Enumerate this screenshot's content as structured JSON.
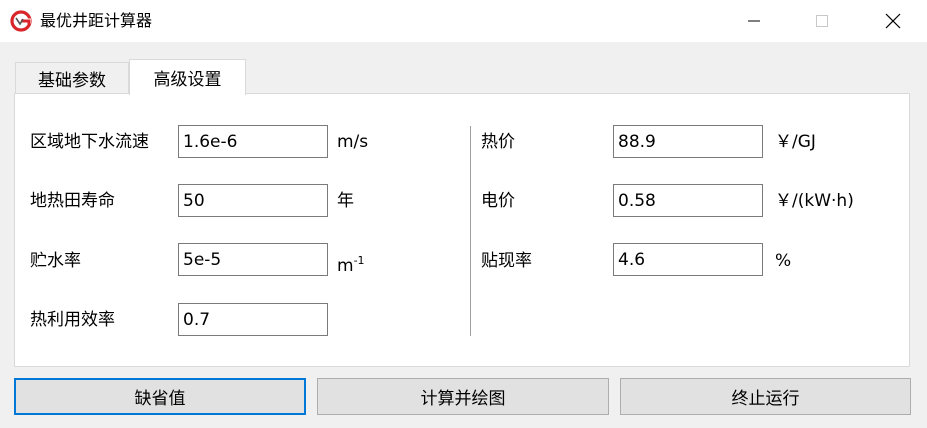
{
  "window": {
    "title": "最优井距计算器",
    "icon": "app-logo-icon",
    "controls": [
      "minimize-icon",
      "maximize-icon",
      "close-icon"
    ]
  },
  "tabs": [
    {
      "label": "基础参数",
      "active": false
    },
    {
      "label": "高级设置",
      "active": true
    }
  ],
  "left_fields": [
    {
      "label": "区域地下水流速",
      "value": "1.6e-6",
      "unit": "m/s"
    },
    {
      "label": "地热田寿命",
      "value": "50",
      "unit": "年"
    },
    {
      "label": "贮水率",
      "value": "5e-5",
      "unit_base": "m",
      "unit_sup": "-1"
    },
    {
      "label": "热利用效率",
      "value": "0.7",
      "unit": ""
    }
  ],
  "right_fields": [
    {
      "label": "热价",
      "value": "88.9",
      "unit": "￥/GJ"
    },
    {
      "label": "电价",
      "value": "0.58",
      "unit": "￥/(kW·h)"
    },
    {
      "label": "贴现率",
      "value": "4.6",
      "unit": "%"
    }
  ],
  "buttons": {
    "default": "缺省值",
    "compute": "计算并绘图",
    "stop": "终止运行"
  },
  "colors": {
    "focus_border": "#0078d7",
    "logo_red": "#d9262b"
  }
}
